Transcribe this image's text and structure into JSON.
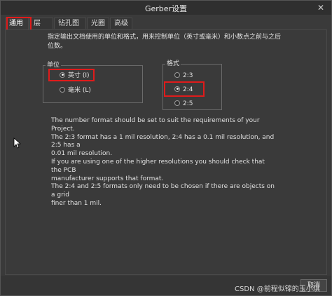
{
  "window": {
    "title": "Gerber设置",
    "close_glyph": "✕"
  },
  "tabs": [
    {
      "label": "通用",
      "active": true
    },
    {
      "label": "层",
      "active": false
    },
    {
      "label": "钻孔图层",
      "active": false
    },
    {
      "label": "光圈",
      "active": false
    },
    {
      "label": "高级",
      "active": false
    }
  ],
  "description": "指定输出文档使用的单位和格式，用来控制单位（英寸或毫米）和小数点之前与之后位数。",
  "units": {
    "title": "单位",
    "options": [
      {
        "label": "英寸 (I)",
        "selected": true
      },
      {
        "label": "毫米 (L)",
        "selected": false
      }
    ]
  },
  "format": {
    "title": "格式",
    "options": [
      {
        "label": "2:3",
        "selected": false
      },
      {
        "label": "2:4",
        "selected": true
      },
      {
        "label": "2:5",
        "selected": false
      }
    ]
  },
  "info_lines": [
    "The number format should be set to suit the requirements of your Project.",
    "The 2:3 format has a 1 mil resolution, 2:4 has a 0.1 mil resolution, and 2:5 has a",
    "0.01 mil resolution.",
    "If you are using one of the higher resolutions you should check that the PCB",
    "manufacturer supports that format.",
    "The 2:4 and 2:5 formats only need to be chosen if there are objects on a grid",
    "finer than 1 mil."
  ],
  "footer": {
    "watermark": "CSDN @前程似锦的玉小琪",
    "cancel_label": "取消"
  },
  "colors": {
    "highlight": "#e01b1b",
    "background": "#3a3a3a",
    "text": "#e0e0e0"
  }
}
